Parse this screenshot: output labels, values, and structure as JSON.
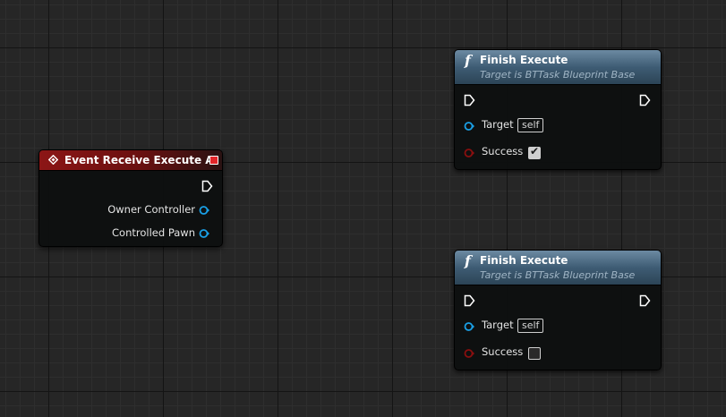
{
  "event_node": {
    "title": "Event Receive Execute AI",
    "pins": [
      {
        "label": "Owner Controller"
      },
      {
        "label": "Controlled Pawn"
      }
    ]
  },
  "finish_nodes": [
    {
      "title": "Finish Execute",
      "subtitle": "Target is BTTask Blueprint Base",
      "target_label": "Target",
      "target_value": "self",
      "success_label": "Success",
      "success_checked": true
    },
    {
      "title": "Finish Execute",
      "subtitle": "Target is BTTask Blueprint Base",
      "target_label": "Target",
      "target_value": "self",
      "success_label": "Success",
      "success_checked": false
    }
  ],
  "colors": {
    "event_header": "#8c1616",
    "function_header": "#4a6a84",
    "object_pin": "#1aa0e6",
    "bool_pin": "#8a0f0f",
    "exec_pin": "#ffffff"
  },
  "icons": {
    "event": "event-diamond-icon",
    "function": "function-f-icon",
    "delegate": "delegate-square-icon",
    "checkmark": "✔"
  }
}
